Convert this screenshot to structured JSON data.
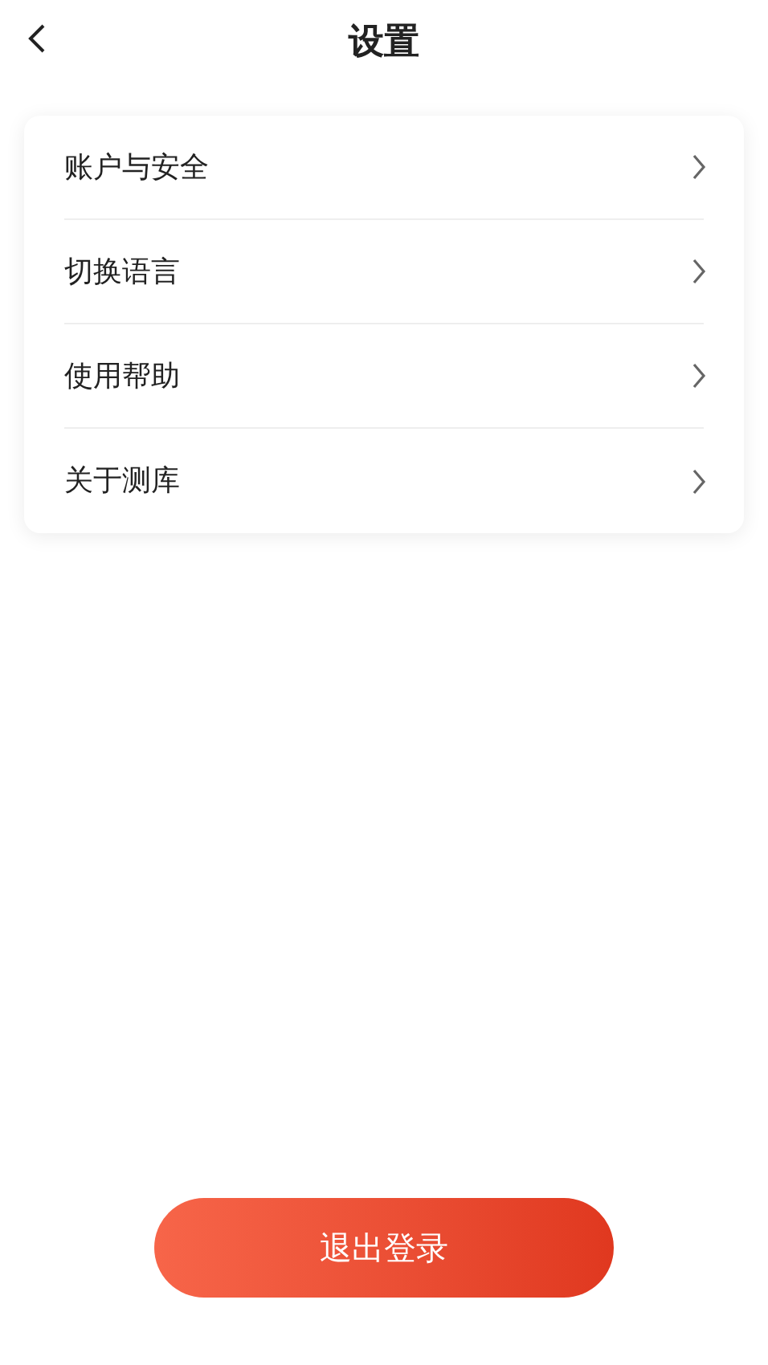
{
  "header": {
    "title": "设置"
  },
  "menu_items": [
    {
      "label": "账户与安全"
    },
    {
      "label": "切换语言"
    },
    {
      "label": "使用帮助"
    },
    {
      "label": "关于测库"
    }
  ],
  "logout_button": {
    "label": "退出登录"
  }
}
